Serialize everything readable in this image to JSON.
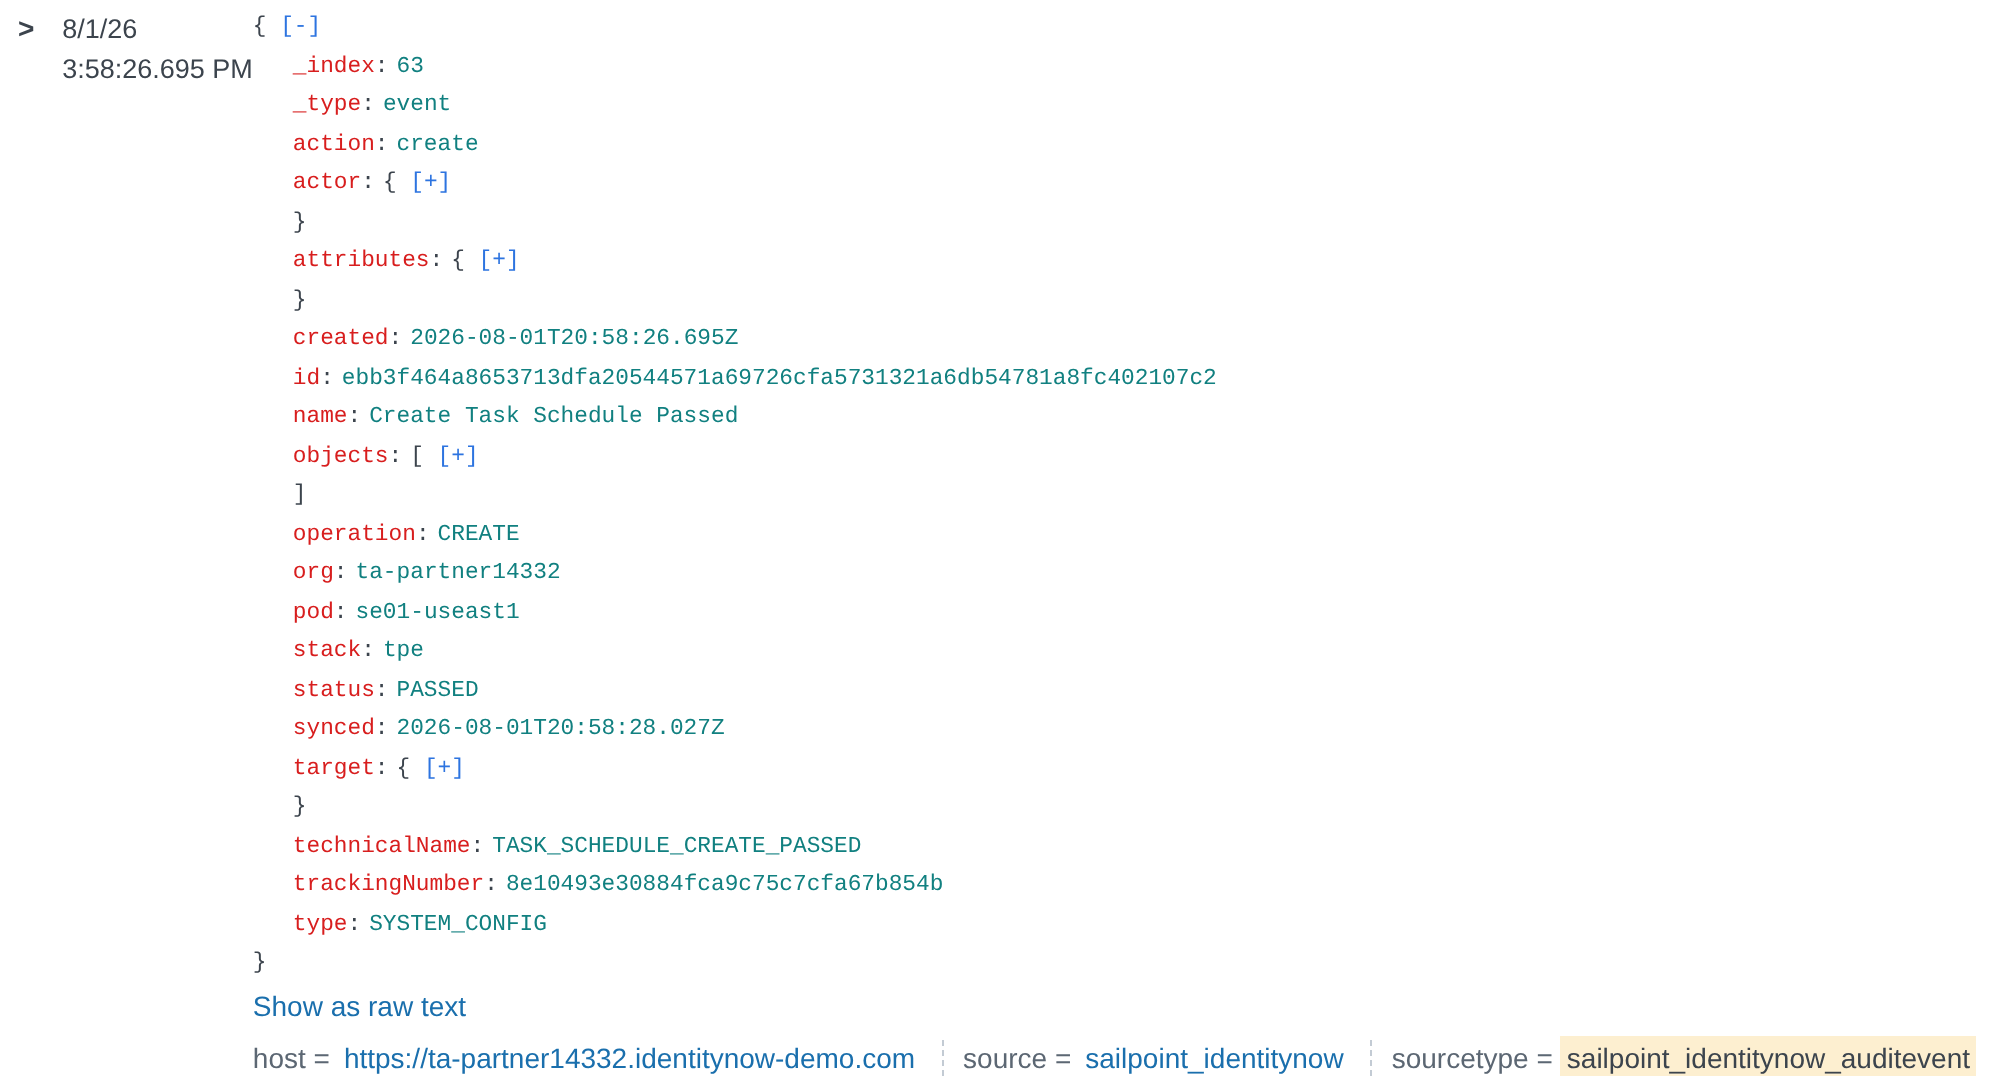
{
  "event": {
    "expand_toggle": ">",
    "date": "8/1/26",
    "time": "3:58:26.695 PM"
  },
  "json": {
    "separator": ":",
    "open": "{",
    "toggle": "[-]",
    "expanded": true,
    "close": "}",
    "fields": [
      {
        "key": "_index",
        "kind": "scalar",
        "value": "63"
      },
      {
        "key": "_type",
        "kind": "scalar",
        "value": "event"
      },
      {
        "key": "action",
        "kind": "scalar",
        "value": "create"
      },
      {
        "key": "actor",
        "kind": "collapsed",
        "open": "{",
        "toggle": "[+]",
        "close": "}"
      },
      {
        "key": "attributes",
        "kind": "collapsed",
        "open": "{",
        "toggle": "[+]",
        "close": "}"
      },
      {
        "key": "created",
        "kind": "scalar",
        "value": "2026-08-01T20:58:26.695Z"
      },
      {
        "key": "id",
        "kind": "scalar",
        "value": "ebb3f464a8653713dfa20544571a69726cfa5731321a6db54781a8fc402107c2"
      },
      {
        "key": "name",
        "kind": "scalar",
        "value": "Create Task Schedule Passed"
      },
      {
        "key": "objects",
        "kind": "collapsed",
        "open": "[",
        "toggle": "[+]",
        "close": "]"
      },
      {
        "key": "operation",
        "kind": "scalar",
        "value": "CREATE"
      },
      {
        "key": "org",
        "kind": "scalar",
        "value": "ta-partner14332"
      },
      {
        "key": "pod",
        "kind": "scalar",
        "value": "se01-useast1"
      },
      {
        "key": "stack",
        "kind": "scalar",
        "value": "tpe"
      },
      {
        "key": "status",
        "kind": "scalar",
        "value": "PASSED"
      },
      {
        "key": "synced",
        "kind": "scalar",
        "value": "2026-08-01T20:58:28.027Z"
      },
      {
        "key": "target",
        "kind": "collapsed",
        "open": "{",
        "toggle": "[+]",
        "close": "}"
      },
      {
        "key": "technicalName",
        "kind": "scalar",
        "value": "TASK_SCHEDULE_CREATE_PASSED"
      },
      {
        "key": "trackingNumber",
        "kind": "scalar",
        "value": "8e10493e30884fca9c75c7cfa67b854b"
      },
      {
        "key": "type",
        "kind": "scalar",
        "value": "SYSTEM_CONFIG"
      }
    ]
  },
  "raw_link": "Show as raw text",
  "footer": [
    {
      "label": "host =",
      "value": "https://ta-partner14332.identitynow-demo.com",
      "highlighted": false
    },
    {
      "label": "source =",
      "value": "sailpoint_identitynow",
      "highlighted": false
    },
    {
      "label": "sourcetype =",
      "value": "sailpoint_identitynow_auditevent",
      "highlighted": true
    }
  ]
}
